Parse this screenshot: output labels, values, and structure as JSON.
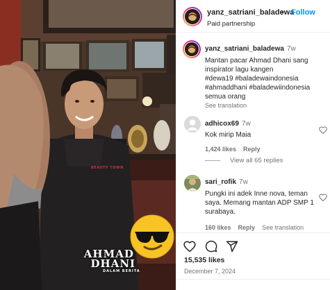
{
  "header": {
    "username": "yanz_satriani_baladewa",
    "separator": "•",
    "follow_label": "Follow",
    "subtitle": "Paid partnership"
  },
  "media": {
    "watermark_line1": "AHMAD",
    "watermark_line2": "DHANI",
    "watermark_line3": "DALAM BERITA",
    "shirt_text": "BEAUTY TOWN",
    "emoji": "😎"
  },
  "caption": {
    "username": "yanz_satriani_baladewa",
    "time": "7w",
    "line1": "Mantan pacar Ahmad Dhani sang",
    "line2": "inspirator lagu kangen",
    "hashtags1": "#dewa19 #baladewaindonesia",
    "hashtags2": "#ahmaddhani #baladewiindonesia",
    "line5": "semua orang",
    "see_translation": "See translation"
  },
  "comments": [
    {
      "username": "adhicox69",
      "time": "7w",
      "text": "Kok mirip Maia",
      "likes": "1,424 likes",
      "reply": "Reply"
    },
    {
      "username": "sari_rofik",
      "time": "7w",
      "line1": "Pungki ini adek Inne nova, teman",
      "line2": "saya. Memang mantan ADP SMP 1",
      "line3": "surabaya.",
      "likes": "160 likes",
      "reply": "Reply",
      "see_translation": "See translation"
    }
  ],
  "view_replies": "View all 65 replies",
  "post": {
    "likes": "15,535 likes",
    "date": "December 7, 2024"
  },
  "colors": {
    "accent": "#0095f6",
    "hashtag": "#00376b",
    "secondary_text": "#737373"
  }
}
